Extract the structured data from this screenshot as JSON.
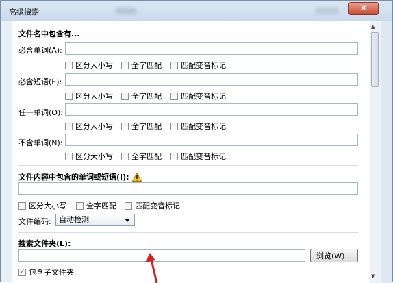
{
  "window": {
    "title": "高级搜索",
    "close_glyph": "✕"
  },
  "filename_section": {
    "heading": "文件名中包含有...",
    "rows": [
      {
        "label": "必含单词(A):",
        "value": ""
      },
      {
        "label": "必含短语(E):",
        "value": ""
      },
      {
        "label": "任一单词(O):",
        "value": ""
      },
      {
        "label": "不含单词(N):",
        "value": ""
      }
    ],
    "options": {
      "case": "区分大小写",
      "whole": "全字匹配",
      "accent": "匹配变音标记"
    }
  },
  "content_section": {
    "heading": "文件内容中包含的单词或短语(I):",
    "warning_icon": "warning-icon",
    "value": "",
    "options": {
      "case": "区分大小写",
      "whole": "全字匹配",
      "accent": "匹配变音标记"
    },
    "encoding_label": "文件编码:",
    "encoding_value": "自动检测"
  },
  "folder_section": {
    "heading": "搜索文件夹(L):",
    "value": "",
    "browse_label": "浏览(W)...",
    "subfolders_label": "包含子文件夹",
    "subfolders_checked": true,
    "check_glyph": "✓"
  },
  "colors": {
    "annotation_arrow": "#d42020",
    "title_bar": "#c9d9ec",
    "close_button": "#c84a30"
  }
}
